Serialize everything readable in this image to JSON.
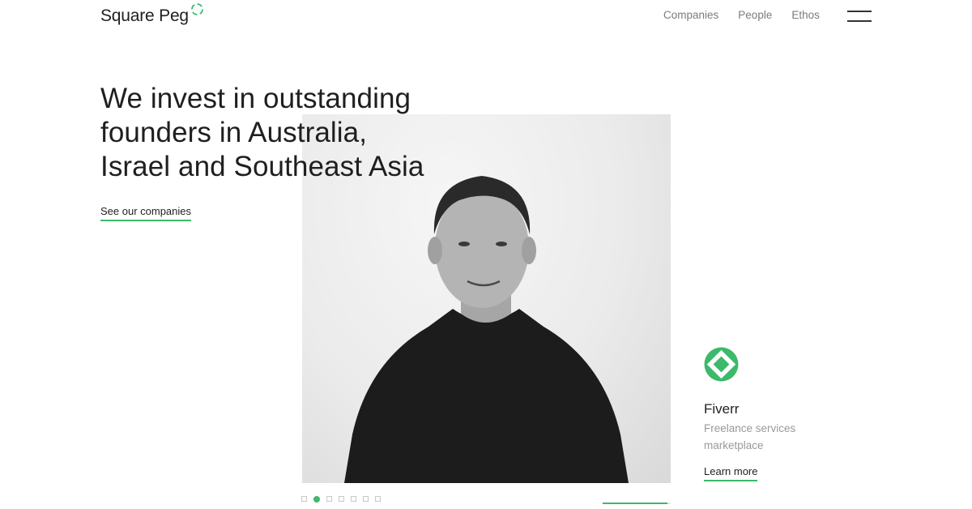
{
  "brand": {
    "name": "Square Peg",
    "accent_color": "#3cb96a",
    "logo_mark_icon": "dashed-circle-icon"
  },
  "nav": {
    "items": [
      "Companies",
      "People",
      "Ethos"
    ],
    "menu_icon": "hamburger-icon"
  },
  "hero": {
    "headline_lines": [
      "We invest in outstanding",
      "founders in Australia,",
      "Israel and Southeast Asia"
    ],
    "cta_label": "See our companies"
  },
  "slider": {
    "slide_count": 7,
    "active_index": 1,
    "progress": 0.95
  },
  "company": {
    "logo_icon": "fiverr-logo-icon",
    "name": "Fiverr",
    "description": "Freelance services marketplace",
    "link_label": "Learn more"
  }
}
